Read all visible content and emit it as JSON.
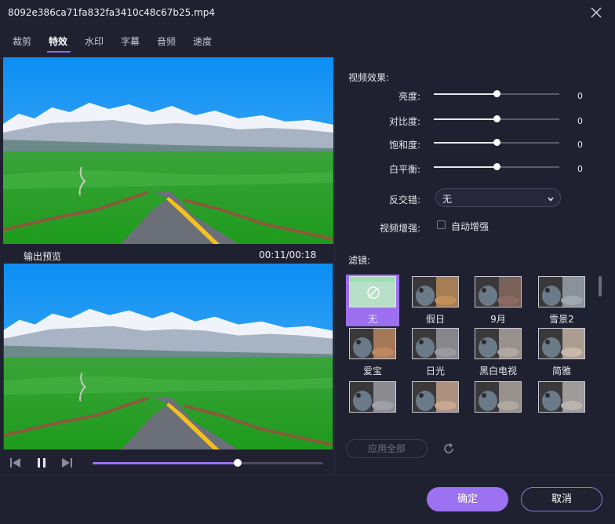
{
  "window": {
    "title": "8092e386ca71fa832fa3410c48c67b25.mp4"
  },
  "tabs": [
    {
      "label": "裁剪"
    },
    {
      "label": "特效"
    },
    {
      "label": "水印"
    },
    {
      "label": "字幕"
    },
    {
      "label": "音频"
    },
    {
      "label": "速度"
    }
  ],
  "active_tab": "特效",
  "preview": {
    "output_label": "输出预览",
    "timecode": "00:11/00:18"
  },
  "player": {
    "progress": 0.63
  },
  "effects": {
    "section_label": "视频效果:",
    "sliders": [
      {
        "label": "亮度:",
        "value": "0",
        "level": 0.5
      },
      {
        "label": "对比度:",
        "value": "0",
        "level": 0.5
      },
      {
        "label": "饱和度:",
        "value": "0",
        "level": 0.5
      },
      {
        "label": "白平衡:",
        "value": "0",
        "level": 0.5
      }
    ],
    "deinterlace_label": "反交错:",
    "deinterlace_value": "无",
    "enhance_label": "视频增强:",
    "auto_enhance_label": "自动增强",
    "auto_enhance_checked": false
  },
  "filters": {
    "section_label": "滤镜:",
    "items": [
      {
        "name": "无",
        "selected": true
      },
      {
        "name": "假日"
      },
      {
        "name": "9月"
      },
      {
        "name": "雪景2"
      },
      {
        "name": "爱宝"
      },
      {
        "name": "日光"
      },
      {
        "name": "黑白电视"
      },
      {
        "name": "简雅"
      },
      {
        "name": ""
      },
      {
        "name": ""
      },
      {
        "name": ""
      },
      {
        "name": ""
      }
    ]
  },
  "actions": {
    "apply_all": "应用全部",
    "ok": "确定",
    "cancel": "取消"
  },
  "colors": {
    "accent": "#9c72f2",
    "background": "#202130"
  }
}
